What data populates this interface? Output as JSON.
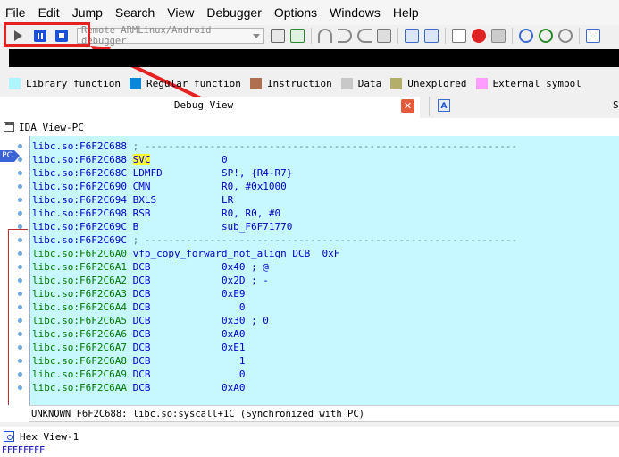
{
  "menubar": {
    "items": [
      "File",
      "Edit",
      "Jump",
      "Search",
      "View",
      "Debugger",
      "Options",
      "Windows",
      "Help"
    ]
  },
  "toolbar": {
    "debugger_select": "Remote ARMLinux/Android debugger"
  },
  "legend": [
    {
      "label": "Library function",
      "color": "#aef5ff"
    },
    {
      "label": "Regular function",
      "color": "#0a87d8"
    },
    {
      "label": "Instruction",
      "color": "#b0704f"
    },
    {
      "label": "Data",
      "color": "#c8c8c8"
    },
    {
      "label": "Unexplored",
      "color": "#b3ae6a"
    },
    {
      "label": "External symbol",
      "color": "#ff9cff"
    }
  ],
  "tabs": {
    "debug_view": "Debug View",
    "third_tab_initial": "S"
  },
  "ida_view": {
    "title": "IDA View-PC",
    "pc_label": "PC",
    "lines": [
      {
        "addr": "libc.so:F6F2C688",
        "mnem": "",
        "ops": "; ---------------------------------------------------------------",
        "kind": "blue",
        "highlight": false
      },
      {
        "addr": "libc.so:F6F2C688",
        "mnem": "SVC",
        "ops": "0",
        "kind": "blue",
        "highlight": true
      },
      {
        "addr": "libc.so:F6F2C68C",
        "mnem": "LDMFD",
        "ops": "SP!, {R4-R7}",
        "kind": "blue",
        "highlight": false
      },
      {
        "addr": "libc.so:F6F2C690",
        "mnem": "CMN",
        "ops": "R0, #0x1000",
        "kind": "blue",
        "highlight": false
      },
      {
        "addr": "libc.so:F6F2C694",
        "mnem": "BXLS",
        "ops": "LR",
        "kind": "blue",
        "highlight": false
      },
      {
        "addr": "libc.so:F6F2C698",
        "mnem": "RSB",
        "ops": "R0, R0, #0",
        "kind": "blue",
        "highlight": false
      },
      {
        "addr": "libc.so:F6F2C69C",
        "mnem": "B",
        "ops": "sub_F6F71770",
        "kind": "blue",
        "highlight": false
      },
      {
        "addr": "libc.so:F6F2C69C",
        "mnem": "",
        "ops": "; ---------------------------------------------------------------",
        "kind": "blue",
        "highlight": false
      },
      {
        "addr": "libc.so:F6F2C6A0",
        "mnem": "vfp_copy_forward_not_align",
        "ops": "DCB  0xF",
        "kind": "green",
        "highlight": false
      },
      {
        "addr": "libc.so:F6F2C6A1",
        "mnem": "DCB",
        "ops": "0x40 ; @",
        "kind": "green",
        "highlight": false
      },
      {
        "addr": "libc.so:F6F2C6A2",
        "mnem": "DCB",
        "ops": "0x2D ; -",
        "kind": "green",
        "highlight": false
      },
      {
        "addr": "libc.so:F6F2C6A3",
        "mnem": "DCB",
        "ops": "0xE9",
        "kind": "green",
        "highlight": false
      },
      {
        "addr": "libc.so:F6F2C6A4",
        "mnem": "DCB",
        "ops": "   0",
        "kind": "green",
        "highlight": false
      },
      {
        "addr": "libc.so:F6F2C6A5",
        "mnem": "DCB",
        "ops": "0x30 ; 0",
        "kind": "green",
        "highlight": false
      },
      {
        "addr": "libc.so:F6F2C6A6",
        "mnem": "DCB",
        "ops": "0xA0",
        "kind": "green",
        "highlight": false
      },
      {
        "addr": "libc.so:F6F2C6A7",
        "mnem": "DCB",
        "ops": "0xE1",
        "kind": "green",
        "highlight": false
      },
      {
        "addr": "libc.so:F6F2C6A8",
        "mnem": "DCB",
        "ops": "   1",
        "kind": "green",
        "highlight": false
      },
      {
        "addr": "libc.so:F6F2C6A9",
        "mnem": "DCB",
        "ops": "   0",
        "kind": "green",
        "highlight": false
      },
      {
        "addr": "libc.so:F6F2C6AA",
        "mnem": "DCB",
        "ops": "0xA0",
        "kind": "green",
        "highlight": false
      }
    ],
    "status": "UNKNOWN F6F2C688: libc.so:syscall+1C (Synchronized with PC)"
  },
  "hex_view": {
    "title": "Hex View-1",
    "first_row": "FFFFFFFF"
  },
  "colors": {
    "annotation_red": "#e52222",
    "code_background": "#c8f8ff"
  }
}
